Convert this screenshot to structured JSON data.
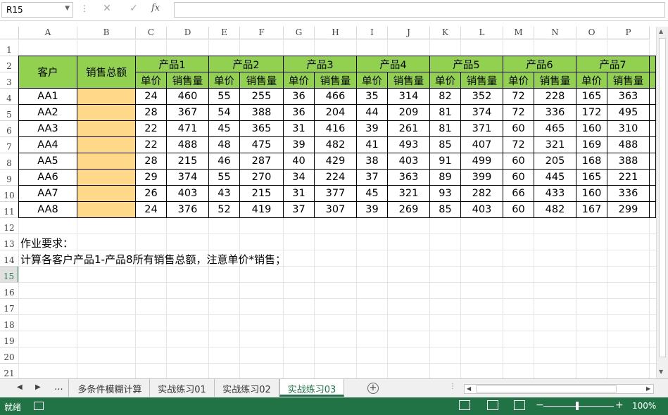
{
  "formula_bar": {
    "name_box": "R15",
    "cancel_icon": "✕",
    "enter_icon": "✓",
    "fx_label": "fx",
    "formula": ""
  },
  "columns": [
    "A",
    "B",
    "C",
    "D",
    "E",
    "F",
    "G",
    "H",
    "I",
    "J",
    "K",
    "L",
    "M",
    "N",
    "O",
    "P"
  ],
  "rows": [
    "1",
    "2",
    "3",
    "4",
    "5",
    "6",
    "7",
    "8",
    "9",
    "10",
    "11",
    "12",
    "13",
    "14",
    "15",
    "16",
    "17",
    "18",
    "19",
    "20",
    "21"
  ],
  "selected_row": "15",
  "table": {
    "customer_header": "客户",
    "total_header": "销售总额",
    "products": [
      "产品1",
      "产品2",
      "产品3",
      "产品4",
      "产品5",
      "产品6",
      "产品7"
    ],
    "price_label": "单价",
    "qty_label": "销售量",
    "data": [
      {
        "customer": "AA1",
        "values": [
          24,
          460,
          55,
          255,
          36,
          466,
          35,
          314,
          82,
          352,
          72,
          228,
          165,
          363
        ]
      },
      {
        "customer": "AA2",
        "values": [
          28,
          367,
          54,
          388,
          36,
          204,
          44,
          209,
          81,
          374,
          72,
          336,
          172,
          495
        ]
      },
      {
        "customer": "AA3",
        "values": [
          22,
          471,
          45,
          365,
          31,
          416,
          39,
          261,
          81,
          371,
          60,
          465,
          160,
          310
        ]
      },
      {
        "customer": "AA4",
        "values": [
          22,
          488,
          48,
          475,
          39,
          482,
          41,
          493,
          85,
          407,
          72,
          321,
          169,
          488
        ]
      },
      {
        "customer": "AA5",
        "values": [
          28,
          215,
          46,
          287,
          40,
          429,
          38,
          403,
          91,
          499,
          60,
          205,
          168,
          388
        ]
      },
      {
        "customer": "AA6",
        "values": [
          29,
          374,
          55,
          270,
          34,
          224,
          37,
          363,
          89,
          399,
          60,
          445,
          165,
          221
        ]
      },
      {
        "customer": "AA7",
        "values": [
          26,
          403,
          43,
          215,
          31,
          377,
          45,
          321,
          93,
          282,
          66,
          433,
          160,
          336
        ]
      },
      {
        "customer": "AA8",
        "values": [
          24,
          376,
          52,
          419,
          37,
          307,
          39,
          269,
          85,
          403,
          60,
          482,
          167,
          299
        ]
      }
    ]
  },
  "notes": {
    "line1": "作业要求：",
    "line2": "计算各客户产品1-产品8所有销售总额，注意单价*销售；"
  },
  "sheet_tabs": {
    "more": "...",
    "tabs": [
      "多条件模糊计算",
      "实战练习01",
      "实战练习02",
      "实战练习03"
    ],
    "active_index": 3
  },
  "status_bar": {
    "ready": "就绪",
    "zoom": "100%"
  },
  "colors": {
    "header_green": "#92d050",
    "total_orange": "#ffd88a",
    "excel_green": "#217346"
  }
}
